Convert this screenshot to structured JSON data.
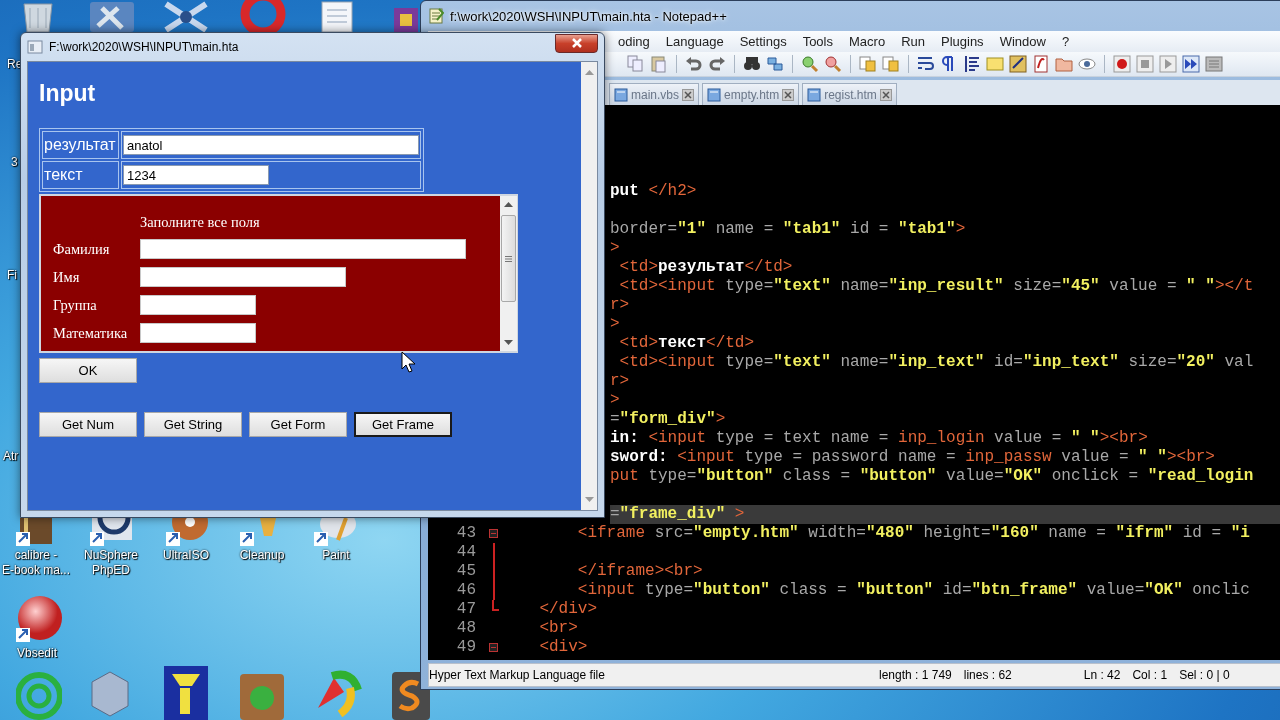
{
  "desktop": {
    "icons": [
      {
        "label_lines": [
          "Re"
        ]
      },
      {
        "label_lines": [
          "3"
        ]
      },
      {
        "label_lines": [
          "Fi"
        ]
      },
      {
        "label_lines": [
          "Atr"
        ]
      },
      {
        "label_lines": [
          "calibre -",
          "E-book ma..."
        ]
      },
      {
        "label_lines": [
          "NuSphere",
          "PhpED"
        ]
      },
      {
        "label_lines": [
          "UltraISO"
        ]
      },
      {
        "label_lines": [
          "Cleanup"
        ]
      },
      {
        "label_lines": [
          "Paint"
        ]
      },
      {
        "label_lines": [
          "Vbsedit"
        ]
      }
    ]
  },
  "notepad": {
    "title": "f:\\work\\2020\\WSH\\INPUT\\main.hta - Notepad++",
    "menu": [
      "oding",
      "Language",
      "Settings",
      "Tools",
      "Macro",
      "Run",
      "Plugins",
      "Window",
      "?"
    ],
    "tabs": [
      {
        "label": "main.vbs",
        "selected": false
      },
      {
        "label": "empty.htm",
        "selected": false
      },
      {
        "label": "regist.htm",
        "selected": false
      }
    ],
    "editor": {
      "lines": [
        {
          "current": false,
          "segments": [
            {
              "kind": "text",
              "text": "put "
            },
            {
              "kind": "tag",
              "text": "</h2>"
            }
          ]
        },
        {
          "current": false
        },
        {
          "current": false,
          "segments": [
            {
              "kind": "attr",
              "text": "border="
            },
            {
              "kind": "str",
              "text": "\"1\""
            },
            {
              "kind": "attr",
              "text": " name = "
            },
            {
              "kind": "str",
              "text": "\"tab1\""
            },
            {
              "kind": "attr",
              "text": " id = "
            },
            {
              "kind": "str",
              "text": "\"tab1\""
            },
            {
              "kind": "tag",
              "text": ">"
            }
          ]
        },
        {
          "current": false,
          "segments": [
            {
              "kind": "tag",
              "text": ">"
            }
          ]
        },
        {
          "current": false,
          "segments": [
            {
              "kind": "tag",
              "text": " <td>"
            },
            {
              "kind": "text",
              "text": "результат"
            },
            {
              "kind": "tag",
              "text": "</td>"
            }
          ]
        },
        {
          "current": false,
          "segments": [
            {
              "kind": "tag",
              "text": " <td><input"
            },
            {
              "kind": "attr",
              "text": " type="
            },
            {
              "kind": "str",
              "text": "\"text\""
            },
            {
              "kind": "attr",
              "text": " name="
            },
            {
              "kind": "str",
              "text": "\"inp_result\""
            },
            {
              "kind": "attr",
              "text": " size="
            },
            {
              "kind": "str",
              "text": "\"45\""
            },
            {
              "kind": "attr",
              "text": " value = "
            },
            {
              "kind": "str",
              "text": "\" \""
            },
            {
              "kind": "tag",
              "text": "></t"
            }
          ]
        },
        {
          "current": false,
          "segments": [
            {
              "kind": "tag",
              "text": "r>"
            }
          ]
        },
        {
          "current": false,
          "segments": [
            {
              "kind": "tag",
              "text": ">"
            }
          ]
        },
        {
          "current": false,
          "segments": [
            {
              "kind": "tag",
              "text": " <td>"
            },
            {
              "kind": "text",
              "text": "текст"
            },
            {
              "kind": "tag",
              "text": "</td>"
            }
          ]
        },
        {
          "current": false,
          "segments": [
            {
              "kind": "tag",
              "text": " <td><input"
            },
            {
              "kind": "attr",
              "text": " type="
            },
            {
              "kind": "str",
              "text": "\"text\""
            },
            {
              "kind": "attr",
              "text": " name="
            },
            {
              "kind": "str",
              "text": "\"inp_text\""
            },
            {
              "kind": "attr",
              "text": " id="
            },
            {
              "kind": "str",
              "text": "\"inp_text\""
            },
            {
              "kind": "attr",
              "text": " size="
            },
            {
              "kind": "str",
              "text": "\"20\""
            },
            {
              "kind": "attr",
              "text": " val"
            }
          ]
        },
        {
          "current": false,
          "segments": [
            {
              "kind": "tag",
              "text": "r>"
            }
          ]
        },
        {
          "current": false,
          "segments": [
            {
              "kind": "tag",
              "text": ">"
            }
          ]
        },
        {
          "current": false,
          "segments": [
            {
              "kind": "attr",
              "text": "="
            },
            {
              "kind": "str",
              "text": "\"form_div\""
            },
            {
              "kind": "tag",
              "text": ">"
            }
          ]
        },
        {
          "current": false,
          "segments": [
            {
              "kind": "text",
              "text": "in:"
            },
            {
              "kind": "tag",
              "text": " <input"
            },
            {
              "kind": "attr",
              "text": " type = text name = "
            },
            {
              "kind": "tag",
              "text": "inp_login"
            },
            {
              "kind": "attr",
              "text": " value = "
            },
            {
              "kind": "str",
              "text": "\" \""
            },
            {
              "kind": "tag",
              "text": "><br>"
            }
          ]
        },
        {
          "current": false,
          "segments": [
            {
              "kind": "text",
              "text": "sword:"
            },
            {
              "kind": "tag",
              "text": " <input"
            },
            {
              "kind": "attr",
              "text": " type = password name = "
            },
            {
              "kind": "tag",
              "text": "inp_passw"
            },
            {
              "kind": "attr",
              "text": " value = "
            },
            {
              "kind": "str",
              "text": "\" \""
            },
            {
              "kind": "tag",
              "text": "><br>"
            }
          ]
        },
        {
          "current": false,
          "segments": [
            {
              "kind": "tag",
              "text": "put"
            },
            {
              "kind": "attr",
              "text": " type="
            },
            {
              "kind": "str",
              "text": "\"button\""
            },
            {
              "kind": "attr",
              "text": " class = "
            },
            {
              "kind": "str",
              "text": "\"button\""
            },
            {
              "kind": "attr",
              "text": " value="
            },
            {
              "kind": "str",
              "text": "\"OK\""
            },
            {
              "kind": "attr",
              "text": " onclick = "
            },
            {
              "kind": "str",
              "text": "\"read_login"
            }
          ]
        },
        {
          "current": false
        },
        {
          "current": true,
          "segments": [
            {
              "kind": "attr",
              "text": "="
            },
            {
              "kind": "str",
              "text": "\"frame_div\""
            },
            {
              "kind": "tag",
              "text": " >"
            }
          ]
        },
        {
          "current": false,
          "number": "43",
          "segments": [
            {
              "kind": "tag",
              "text": "        <iframe"
            },
            {
              "kind": "attr",
              "text": " src="
            },
            {
              "kind": "str",
              "text": "\"empty.htm\""
            },
            {
              "kind": "attr",
              "text": " width="
            },
            {
              "kind": "str",
              "text": "\"480\""
            },
            {
              "kind": "attr",
              "text": " height="
            },
            {
              "kind": "str",
              "text": "\"160\""
            },
            {
              "kind": "attr",
              "text": " name = "
            },
            {
              "kind": "str",
              "text": "\"ifrm\""
            },
            {
              "kind": "attr",
              "text": " id = "
            },
            {
              "kind": "str",
              "text": "\"i"
            }
          ]
        },
        {
          "current": false,
          "number": "44"
        },
        {
          "current": false,
          "number": "45",
          "segments": [
            {
              "kind": "tag",
              "text": "        </iframe><br>"
            }
          ]
        },
        {
          "current": false,
          "number": "46",
          "segments": [
            {
              "kind": "tag",
              "text": "        <input"
            },
            {
              "kind": "attr",
              "text": " type="
            },
            {
              "kind": "str",
              "text": "\"button\""
            },
            {
              "kind": "attr",
              "text": " class = "
            },
            {
              "kind": "str",
              "text": "\"button\""
            },
            {
              "kind": "attr",
              "text": " id="
            },
            {
              "kind": "str",
              "text": "\"btn_frame\""
            },
            {
              "kind": "attr",
              "text": " value="
            },
            {
              "kind": "str",
              "text": "\"OK\""
            },
            {
              "kind": "attr",
              "text": " onclic"
            }
          ]
        },
        {
          "current": false,
          "number": "47",
          "segments": [
            {
              "kind": "tag",
              "text": "    </div>"
            }
          ]
        },
        {
          "current": false,
          "number": "48",
          "segments": [
            {
              "kind": "tag",
              "text": "    <br>"
            }
          ]
        },
        {
          "current": false,
          "number": "49",
          "segments": [
            {
              "kind": "tag",
              "text": "    <div>"
            }
          ]
        }
      ]
    },
    "status_bar": {
      "file_type": "Hyper Text Markup Language file",
      "length": "length : 1 749",
      "lines": "lines : 62",
      "ln": "Ln : 42",
      "col": "Col : 1",
      "sel": "Sel : 0 | 0"
    }
  },
  "hta": {
    "title": "F:\\work\\2020\\WSH\\INPUT\\main.hta",
    "heading": "Input",
    "table": {
      "rows": [
        {
          "label": "результат",
          "value": "anatol"
        },
        {
          "label": "текст",
          "value": "1234"
        }
      ]
    },
    "frame": {
      "title": "Заполните все поля",
      "fields": [
        {
          "label": "Фамилия"
        },
        {
          "label": "Имя"
        },
        {
          "label": "Группа"
        },
        {
          "label": "Математика"
        }
      ]
    },
    "ok_button": {
      "label": "OK"
    },
    "buttons": [
      {
        "label": "Get Num",
        "focused": false
      },
      {
        "label": "Get String",
        "focused": false
      },
      {
        "label": "Get Form",
        "focused": false
      },
      {
        "label": "Get Frame",
        "focused": true
      }
    ]
  }
}
